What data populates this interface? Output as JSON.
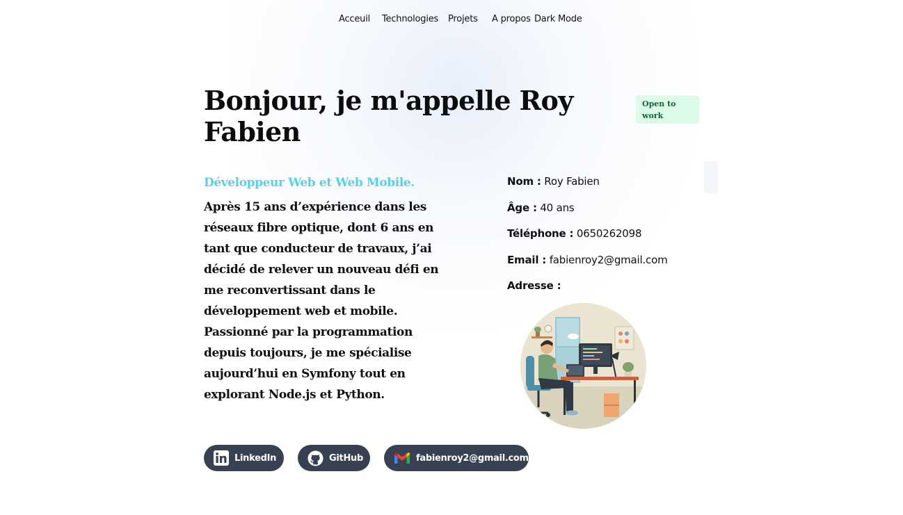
{
  "nav": {
    "items": [
      "Acceuil",
      "Technologies",
      "Projets",
      "A propos"
    ],
    "dark_mode": "Dark Mode"
  },
  "hero": {
    "title": "Bonjour, je m'appelle Roy Fabien",
    "badge": "Open to work"
  },
  "about": {
    "subtitle": "Développeur Web et Web Mobile.",
    "bio": "Après 15 ans d’expérience dans les réseaux fibre optique, dont 6 ans en tant que conducteur de travaux, j’ai décidé de relever un nouveau défi en me reconvertissant dans le développement web et mobile. Passionné par la programmation depuis toujours, je me spécialise aujourd’hui en Symfony tout en explorant Node.js et Python."
  },
  "info": {
    "name_label": "Nom :",
    "name_value": "Roy Fabien",
    "age_label": "Âge :",
    "age_value": "40 ans",
    "phone_label": "Téléphone :",
    "phone_value": "0650262098",
    "email_label": "Email :",
    "email_value": "fabienroy2@gmail.com",
    "address_label": "Adresse :",
    "address_value": ""
  },
  "social": {
    "linkedin": "LinkedIn",
    "github": "GitHub",
    "email": "fabienroy2@gmail.com"
  },
  "icons": {
    "linkedin": "linkedin-icon",
    "github": "github-icon",
    "email": "gmail-icon"
  },
  "colors": {
    "subtitle": "#5ccfe6",
    "badge_bg": "#dcfce7",
    "badge_text": "#166534",
    "button_bg": "#374151"
  }
}
